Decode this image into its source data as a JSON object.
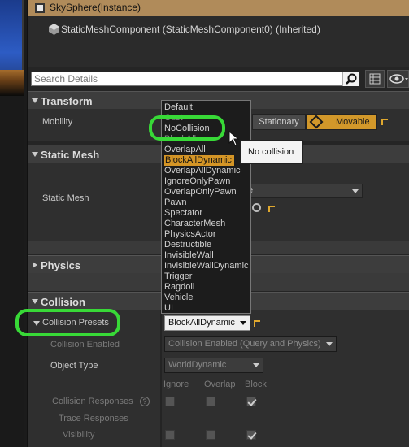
{
  "instance": {
    "title": "SkySphere(Instance)"
  },
  "component": {
    "label": "StaticMeshComponent (StaticMeshComponent0) (Inherited)"
  },
  "search": {
    "placeholder": "Search Details"
  },
  "sections": {
    "transform": "Transform",
    "static_mesh": "Static Mesh",
    "physics": "Physics",
    "collision": "Collision"
  },
  "transform": {
    "mobility_label": "Mobility",
    "stationary_label": "Stationary",
    "movable_label": "Movable"
  },
  "static_mesh": {
    "label": "Static Mesh",
    "value_partial": "e"
  },
  "dropdown": {
    "items": [
      "Default",
      "Cust",
      "NoCollision",
      "BlockAll",
      "OverlapAll",
      "BlockAllDynamic",
      "OverlapAllDynamic",
      "IgnoreOnlyPawn",
      "OverlapOnlyPawn",
      "Pawn",
      "Spectator",
      "CharacterMesh",
      "PhysicsActor",
      "Destructible",
      "InvisibleWall",
      "InvisibleWallDynamic",
      "Trigger",
      "Ragdoll",
      "Vehicle",
      "UI"
    ],
    "selected": "BlockAllDynamic"
  },
  "tooltip": {
    "text": "No collision"
  },
  "collision": {
    "presets_label": "Collision Presets",
    "presets_value": "BlockAllDynamic",
    "enabled_label": "Collision Enabled",
    "enabled_value": "Collision Enabled (Query and Physics)",
    "object_type_label": "Object Type",
    "object_type_value": "WorldDynamic",
    "col_ignore": "Ignore",
    "col_overlap": "Overlap",
    "col_block": "Block",
    "responses_label": "Collision Responses",
    "trace_label": "Trace Responses",
    "visibility_label": "Visibility",
    "help": "?"
  },
  "colors": {
    "accent": "#d49526",
    "highlight": "#38d937",
    "instance_bar": "#b08b5a"
  }
}
